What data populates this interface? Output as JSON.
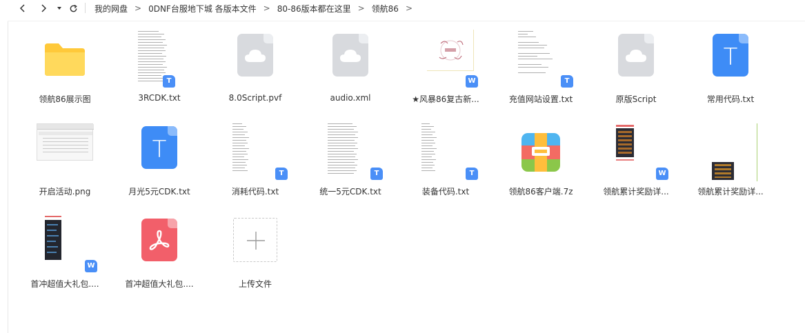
{
  "toolbar": {
    "back_icon": "chevron-left-icon",
    "forward_icon": "chevron-right-icon",
    "history_icon": "caret-down-icon",
    "refresh_icon": "refresh-icon"
  },
  "breadcrumb": [
    "我的网盘",
    "0DNF台服地下城 各版本文件",
    "80-86版本都在这里",
    "领航86"
  ],
  "files": [
    {
      "name": "领航86展示图",
      "kind": "folder"
    },
    {
      "name": "3RCDK.txt",
      "kind": "txt-thumb"
    },
    {
      "name": "8.0Script.pvf",
      "kind": "unknown"
    },
    {
      "name": "audio.xml",
      "kind": "unknown"
    },
    {
      "name": "★风暴86复古新...",
      "kind": "doc-thumb"
    },
    {
      "name": "充值网站设置.txt",
      "kind": "txt-thumb"
    },
    {
      "name": "原版Script",
      "kind": "unknown"
    },
    {
      "name": "常用代码.txt",
      "kind": "txt"
    },
    {
      "name": "开启活动.png",
      "kind": "image"
    },
    {
      "name": "月光5元CDK.txt",
      "kind": "txt"
    },
    {
      "name": "消耗代码.txt",
      "kind": "txt-thumb"
    },
    {
      "name": "统一5元CDK.txt",
      "kind": "txt-thumb"
    },
    {
      "name": "装备代码.txt",
      "kind": "txt-thumb"
    },
    {
      "name": "领航86客户端.7z",
      "kind": "archive"
    },
    {
      "name": "领航累计奖励详...",
      "kind": "doc-thumb"
    },
    {
      "name": "领航累计奖励详...",
      "kind": "image"
    },
    {
      "name": "首冲超值大礼包....",
      "kind": "doc-thumb"
    },
    {
      "name": "首冲超值大礼包....",
      "kind": "pdf"
    },
    {
      "name": "上传文件",
      "kind": "upload"
    }
  ],
  "badges": {
    "txt": "T",
    "doc": "W"
  },
  "colors": {
    "folder": "#ffd04b",
    "txt_blue": "#3e8cf6",
    "pdf_red": "#f25f6a",
    "unknown_gray": "#d8dade"
  }
}
